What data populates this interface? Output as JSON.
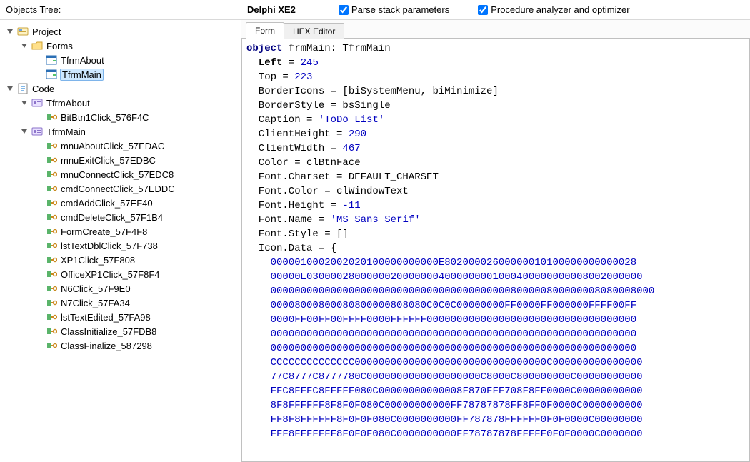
{
  "topbar": {
    "label": "Objects Tree:",
    "title": "Delphi XE2",
    "parse_stack": "Parse stack parameters",
    "proc_analyzer": "Procedure analyzer and optimizer"
  },
  "tree": {
    "project": "Project",
    "forms": "Forms",
    "forms_children": [
      {
        "name": "TfrmAbout",
        "selected": false
      },
      {
        "name": "TfrmMain",
        "selected": true
      }
    ],
    "code": "Code",
    "classes": [
      {
        "name": "TfrmAbout",
        "procs": [
          "BitBtn1Click_576F4C"
        ]
      },
      {
        "name": "TfrmMain",
        "procs": [
          "mnuAboutClick_57EDAC",
          "mnuExitClick_57EDBC",
          "mnuConnectClick_57EDC8",
          "cmdConnectClick_57EDDC",
          "cmdAddClick_57EF40",
          "cmdDeleteClick_57F1B4",
          "FormCreate_57F4F8",
          "lstTextDblClick_57F738",
          "XP1Click_57F808",
          "OfficeXP1Click_57F8F4",
          "N6Click_57F9E0",
          "N7Click_57FA34",
          "lstTextEdited_57FA98",
          "ClassInitialize_57FDB8",
          "ClassFinalize_587298"
        ]
      }
    ]
  },
  "tabs": {
    "form": "Form",
    "hex": "HEX Editor"
  },
  "dfm": {
    "header_object": "object",
    "header_name": "frmMain",
    "header_type": "TfrmMain",
    "props": [
      {
        "name": "Left",
        "bold": true,
        "sep": "=",
        "value": "245",
        "vtype": "num"
      },
      {
        "name": "Top",
        "bold": false,
        "sep": "=",
        "value": "223",
        "vtype": "num"
      },
      {
        "name": "BorderIcons",
        "bold": false,
        "sep": "=",
        "value": "[biSystemMenu, biMinimize]",
        "vtype": "text"
      },
      {
        "name": "BorderStyle",
        "bold": false,
        "sep": "=",
        "value": "bsSingle",
        "vtype": "text"
      },
      {
        "name": "Caption",
        "bold": false,
        "sep": "=",
        "value": "'ToDo List'",
        "vtype": "str"
      },
      {
        "name": "ClientHeight",
        "bold": false,
        "sep": "=",
        "value": "290",
        "vtype": "num"
      },
      {
        "name": "ClientWidth",
        "bold": false,
        "sep": "=",
        "value": "467",
        "vtype": "num"
      },
      {
        "name": "Color",
        "bold": false,
        "sep": "=",
        "value": "clBtnFace",
        "vtype": "text"
      },
      {
        "name": "Font.Charset",
        "bold": false,
        "sep": "=",
        "value": "DEFAULT_CHARSET",
        "vtype": "text"
      },
      {
        "name": "Font.Color",
        "bold": false,
        "sep": "=",
        "value": "clWindowText",
        "vtype": "text"
      },
      {
        "name": "Font.Height",
        "bold": false,
        "sep": "=",
        "value": "-11",
        "vtype": "num"
      },
      {
        "name": "Font.Name",
        "bold": false,
        "sep": "=",
        "value": "'MS Sans Serif'",
        "vtype": "str"
      },
      {
        "name": "Font.Style",
        "bold": false,
        "sep": "=",
        "value": "[]",
        "vtype": "text"
      }
    ],
    "icon_label": "Icon.Data = {",
    "icon_lines": [
      "0000010002002020100000000000E80200002600000010100000000000028",
      "00000E03000028000000200000004000000001000400000000008002000000",
      "0000000000000000000000000000000000000000800000800000008080008000",
      "00008000800080800000808080C0C0C00000000FF0000FF000000FFFF00FF",
      "0000FF00FF00FFFF0000FFFFFF00000000000000000000000000000000000",
      "0000000000000000000000000000000000000000000000000000000000000",
      "0000000000000000000000000000000000000000000000000000000000000",
      "CCCCCCCCCCCCCC00000000000000000000000000000000C000000000000000",
      "77C8777C8777780C0000000000000000000C8000C800000000C00000000000",
      "FFC8FFFC8FFFFF080C00000000000008F870FFF708F8FF0000C00000000000",
      "8F8FFFFFF8F8F0F080C00000000000FF78787878FF8FF0F0000C0000000000",
      "FF8F8FFFFFF8F0F0F080C0000000000FF787878FFFFFF0F0F0000C00000000",
      "FFF8FFFFFFF8F0F0F080C0000000000FF78787878FFFFF0F0F0000C0000000"
    ]
  }
}
